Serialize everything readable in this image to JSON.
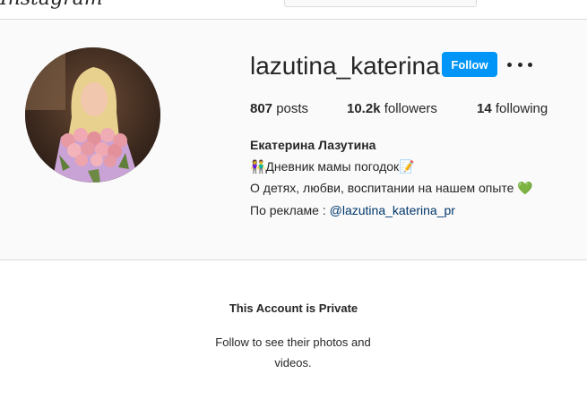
{
  "header": {
    "logo_text": "Instagram"
  },
  "profile": {
    "username": "lazutina_katerina",
    "follow_label": "Follow",
    "posts_count": "807",
    "posts_label": "posts",
    "followers_count": "10.2k",
    "followers_label": "followers",
    "following_count": "14",
    "following_label": "following",
    "full_name": "Екатерина Лазутина",
    "bio_line1": "👫Дневник мамы погодок📝",
    "bio_line2": "О детях, любви, воспитании на нашем опыте 💚",
    "bio_line3_prefix": "По рекламе : ",
    "bio_line3_link": "@lazutina_katerina_pr"
  },
  "private": {
    "title": "This Account is Private",
    "subtitle": "Follow to see their photos and videos."
  },
  "colors": {
    "accent": "#0095f6",
    "link": "#00376b",
    "background": "#fafafa",
    "border": "#dbdbdb"
  },
  "icons": {
    "more": "more-options-icon",
    "avatar": "avatar"
  }
}
